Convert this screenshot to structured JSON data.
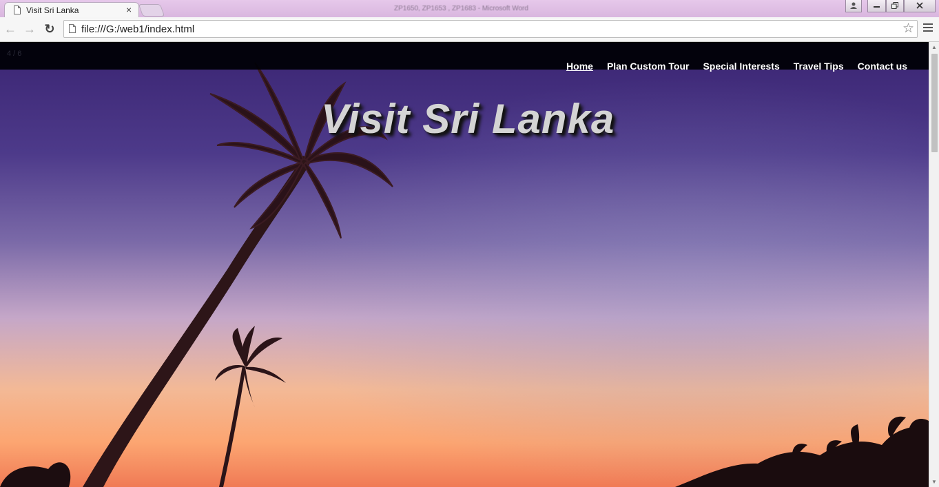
{
  "browser": {
    "window_title": "ZP1650, ZP1653 , ZP1683 - Microsoft Word",
    "tab_title": "Visit Sri Lanka",
    "tab_close": "×",
    "url": "file:///G:/web1/index.html",
    "star": "☆"
  },
  "page": {
    "counter": "4 / 6",
    "title": "Visit Sri Lanka",
    "nav": [
      {
        "label": "Home",
        "active": true
      },
      {
        "label": "Plan Custom Tour"
      },
      {
        "label": "Special Interests"
      },
      {
        "label": "Travel Tips"
      },
      {
        "label": "Contact us"
      }
    ]
  }
}
